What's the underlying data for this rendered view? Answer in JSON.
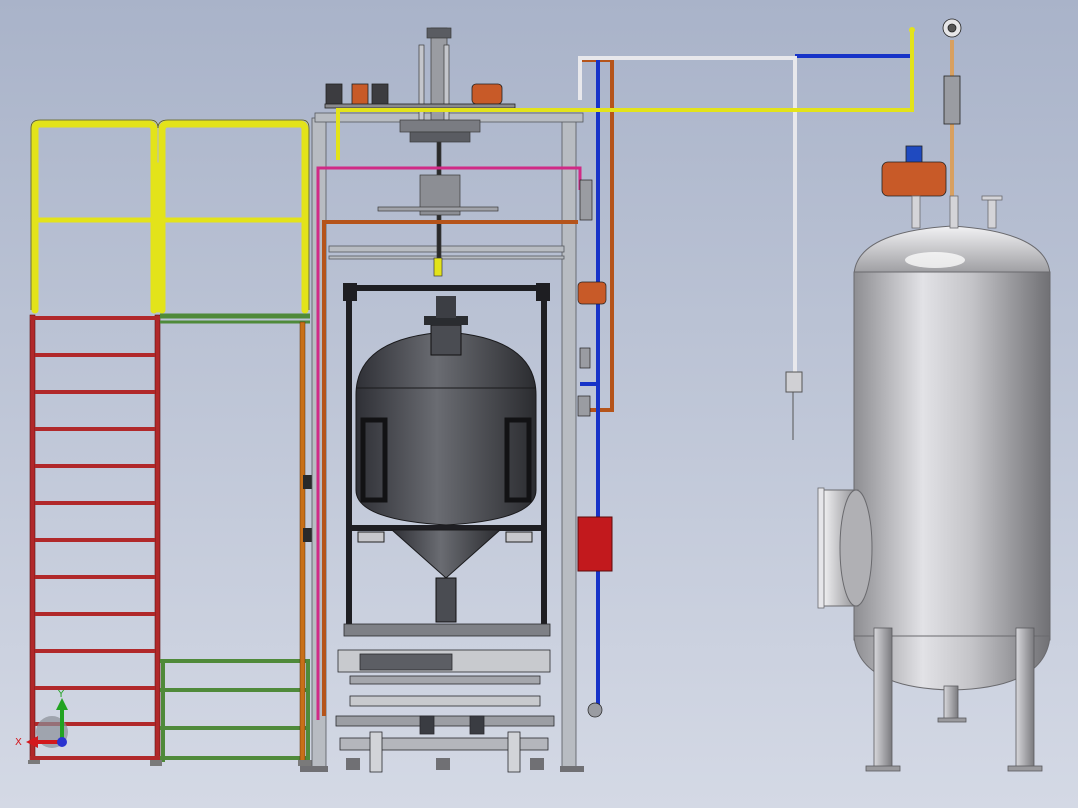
{
  "colors": {
    "background_top": "#a9b3c9",
    "background_bottom": "#d4d9e5",
    "handrail": "#e3e31a",
    "ladder": "#b1282a",
    "platform": "#4f8a3a",
    "frame": "#b8bcc2",
    "vessel_dark": "#4a4c52",
    "receiver_tank": "#c6c6ca",
    "pipe_pink": "#d02a86",
    "pipe_copper": "#b5541a",
    "pipe_blue": "#1733c8",
    "pipe_white": "#e8e8ec",
    "pipe_tan": "#d8a060",
    "valve_actuator": "#c85a28",
    "panel_red": "#c2191d",
    "axis_x": "#d2181d",
    "axis_y": "#22a322",
    "axis_z": "#2a33d0"
  },
  "triad": {
    "x_label": "X",
    "y_label": "Y"
  }
}
